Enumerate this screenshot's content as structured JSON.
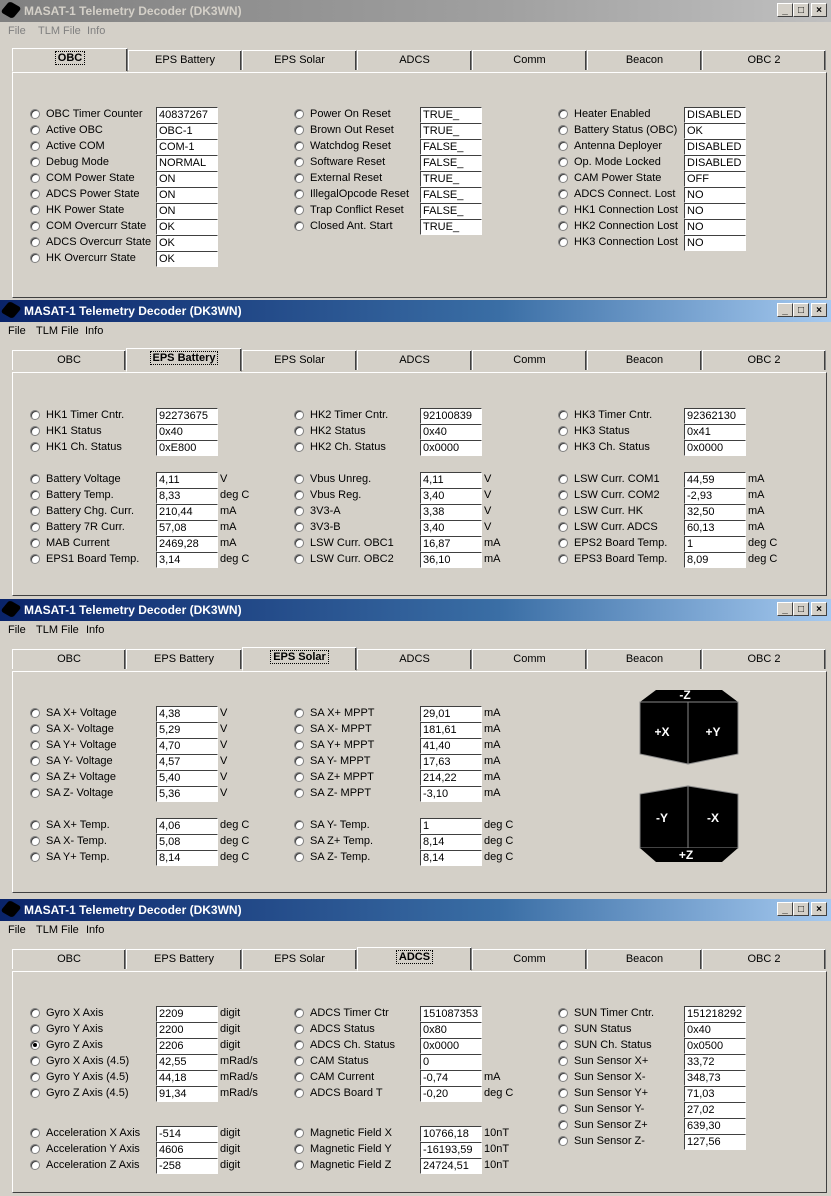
{
  "app": {
    "title": "MASAT-1 Telemetry Decoder (DK3WN)",
    "menu": [
      "File",
      "TLM File",
      "Info"
    ],
    "tabs": [
      "OBC",
      "EPS Battery",
      "EPS  Solar",
      "ADCS",
      "Comm",
      "Beacon",
      "OBC 2"
    ],
    "window_buttons": [
      "_",
      "□",
      "×"
    ]
  },
  "obc": {
    "col1": [
      {
        "label": "OBC Timer Counter",
        "value": "40837267"
      },
      {
        "label": "Active OBC",
        "value": "OBC-1"
      },
      {
        "label": "Active COM",
        "value": "COM-1"
      },
      {
        "label": "Debug Mode",
        "value": "NORMAL"
      },
      {
        "label": "COM Power State",
        "value": "ON"
      },
      {
        "label": "ADCS Power State",
        "value": "ON"
      },
      {
        "label": "HK Power State",
        "value": "ON"
      },
      {
        "label": "COM Overcurr State",
        "value": "OK"
      },
      {
        "label": "ADCS Overcurr State",
        "value": "OK"
      },
      {
        "label": "HK Overcurr State",
        "value": "OK"
      }
    ],
    "col2": [
      {
        "label": "Power On Reset",
        "value": "TRUE_"
      },
      {
        "label": "Brown Out Reset",
        "value": "TRUE_"
      },
      {
        "label": "Watchdog  Reset",
        "value": "FALSE_"
      },
      {
        "label": "Software Reset",
        "value": "FALSE_"
      },
      {
        "label": "External Reset",
        "value": "TRUE_"
      },
      {
        "label": "IllegalOpcode Reset",
        "value": "FALSE_"
      },
      {
        "label": "Trap Conflict Reset",
        "value": "FALSE_"
      },
      {
        "label": "Closed Ant. Start",
        "value": "TRUE_"
      }
    ],
    "col3": [
      {
        "label": "Heater Enabled",
        "value": "DISABLED"
      },
      {
        "label": "Battery Status (OBC)",
        "value": "OK"
      },
      {
        "label": "Antenna Deployer",
        "value": "DISABLED"
      },
      {
        "label": "Op. Mode Locked",
        "value": "DISABLED"
      },
      {
        "label": "CAM Power State",
        "value": "OFF"
      },
      {
        "label": "ADCS Connect. Lost",
        "value": "NO"
      },
      {
        "label": "HK1 Connection Lost",
        "value": "NO"
      },
      {
        "label": "HK2 Connection Lost",
        "value": "NO"
      },
      {
        "label": "HK3 Connection Lost",
        "value": "NO"
      }
    ]
  },
  "eps_battery": {
    "col1a": [
      {
        "label": "HK1 Timer Cntr.",
        "value": "92273675",
        "unit": ""
      },
      {
        "label": "HK1 Status",
        "value": "0x40",
        "unit": ""
      },
      {
        "label": "HK1 Ch. Status",
        "value": "0xE800",
        "unit": ""
      }
    ],
    "col2a": [
      {
        "label": "HK2 Timer Cntr.",
        "value": "92100839",
        "unit": ""
      },
      {
        "label": "HK2 Status",
        "value": "0x40",
        "unit": ""
      },
      {
        "label": "HK2 Ch. Status",
        "value": "0x0000",
        "unit": ""
      }
    ],
    "col3a": [
      {
        "label": "HK3 Timer Cntr.",
        "value": "92362130",
        "unit": ""
      },
      {
        "label": "HK3 Status",
        "value": "0x41",
        "unit": ""
      },
      {
        "label": "HK3 Ch. Status",
        "value": "0x0000",
        "unit": ""
      }
    ],
    "col1b": [
      {
        "label": "Battery Voltage",
        "value": "4,11",
        "unit": "V"
      },
      {
        "label": "Battery Temp.",
        "value": "8,33",
        "unit": "deg C"
      },
      {
        "label": "Battery Chg. Curr.",
        "value": "210,44",
        "unit": "mA"
      },
      {
        "label": "Battery 7R Curr.",
        "value": "57,08",
        "unit": "mA"
      },
      {
        "label": "MAB Current",
        "value": "2469,28",
        "unit": "mA"
      },
      {
        "label": "EPS1 Board Temp.",
        "value": "3,14",
        "unit": "deg C"
      }
    ],
    "col2b": [
      {
        "label": "Vbus Unreg.",
        "value": "4,11",
        "unit": "V"
      },
      {
        "label": "Vbus Reg.",
        "value": "3,40",
        "unit": "V"
      },
      {
        "label": "3V3-A",
        "value": "3,38",
        "unit": "V"
      },
      {
        "label": "3V3-B",
        "value": "3,40",
        "unit": "V"
      },
      {
        "label": "LSW Curr. OBC1",
        "value": "16,87",
        "unit": "mA"
      },
      {
        "label": "LSW Curr. OBC2",
        "value": "36,10",
        "unit": "mA"
      }
    ],
    "col3b": [
      {
        "label": "LSW Curr. COM1",
        "value": "44,59",
        "unit": "mA"
      },
      {
        "label": "LSW Curr. COM2",
        "value": "-2,93",
        "unit": "mA"
      },
      {
        "label": "LSW Curr. HK",
        "value": "32,50",
        "unit": "mA"
      },
      {
        "label": "LSW Curr. ADCS",
        "value": "60,13",
        "unit": "mA"
      },
      {
        "label": "EPS2 Board Temp.",
        "value": "1",
        "unit": "deg C"
      },
      {
        "label": "EPS3 Board Temp.",
        "value": "8,09",
        "unit": "deg C"
      }
    ]
  },
  "eps_solar": {
    "col1a": [
      {
        "label": "SA X+ Voltage",
        "value": "4,38",
        "unit": "V"
      },
      {
        "label": "SA X- Voltage",
        "value": "5,29",
        "unit": "V"
      },
      {
        "label": "SA Y+ Voltage",
        "value": "4,70",
        "unit": "V"
      },
      {
        "label": "SA Y- Voltage",
        "value": "4,57",
        "unit": "V"
      },
      {
        "label": "SA Z+ Voltage",
        "value": "5,40",
        "unit": "V"
      },
      {
        "label": "SA Z- Voltage",
        "value": "5,36",
        "unit": "V"
      }
    ],
    "col2a": [
      {
        "label": "SA X+ MPPT",
        "value": "29,01",
        "unit": "mA"
      },
      {
        "label": "SA X- MPPT",
        "value": "181,61",
        "unit": "mA"
      },
      {
        "label": "SA Y+ MPPT",
        "value": "41,40",
        "unit": "mA"
      },
      {
        "label": "SA Y- MPPT",
        "value": "17,63",
        "unit": "mA"
      },
      {
        "label": "SA Z+ MPPT",
        "value": "214,22",
        "unit": "mA"
      },
      {
        "label": "SA Z- MPPT",
        "value": "-3,10",
        "unit": "mA"
      }
    ],
    "col1b": [
      {
        "label": "SA X+ Temp.",
        "value": "4,06",
        "unit": "deg C"
      },
      {
        "label": "SA X- Temp.",
        "value": "5,08",
        "unit": "deg C"
      },
      {
        "label": "SA Y+ Temp.",
        "value": "8,14",
        "unit": "deg C"
      }
    ],
    "col2b": [
      {
        "label": "SA Y- Temp.",
        "value": "1",
        "unit": "deg C"
      },
      {
        "label": "SA Z+ Temp.",
        "value": "8,14",
        "unit": "deg C"
      },
      {
        "label": "SA Z- Temp.",
        "value": "8,14",
        "unit": "deg C"
      }
    ],
    "cube1": {
      "top": "-Z",
      "left": "+X",
      "right": "+Y"
    },
    "cube2": {
      "left": "-Y",
      "right": "-X",
      "bottom": "+Z"
    }
  },
  "adcs": {
    "col1a": [
      {
        "label": "Gyro X Axis",
        "value": "2209",
        "unit": "digit",
        "checked": false
      },
      {
        "label": "Gyro Y Axis",
        "value": "2200",
        "unit": "digit",
        "checked": false
      },
      {
        "label": "Gyro Z Axis",
        "value": "2206",
        "unit": "digit",
        "checked": true
      },
      {
        "label": "Gyro X Axis (4.5)",
        "value": "42,55",
        "unit": "mRad/s",
        "checked": false
      },
      {
        "label": "Gyro Y Axis (4.5)",
        "value": "44,18",
        "unit": "mRad/s",
        "checked": false
      },
      {
        "label": "Gyro Z Axis (4.5)",
        "value": "91,34",
        "unit": "mRad/s",
        "checked": false
      }
    ],
    "col2a": [
      {
        "label": "ADCS Timer Ctr",
        "value": "151087353",
        "unit": ""
      },
      {
        "label": "ADCS Status",
        "value": "0x80",
        "unit": ""
      },
      {
        "label": "ADCS Ch. Status",
        "value": "0x0000",
        "unit": ""
      },
      {
        "label": "CAM Status",
        "value": "0",
        "unit": ""
      },
      {
        "label": "CAM Current",
        "value": "-0,74",
        "unit": "mA"
      },
      {
        "label": "ADCS Board T",
        "value": "-0,20",
        "unit": "deg C"
      }
    ],
    "col3": [
      {
        "label": "SUN Timer Cntr.",
        "value": "151218292"
      },
      {
        "label": "SUN Status",
        "value": "0x40"
      },
      {
        "label": "SUN Ch. Status",
        "value": "0x0500"
      },
      {
        "label": "Sun Sensor X+",
        "value": "33,72"
      },
      {
        "label": "Sun Sensor X-",
        "value": "348,73"
      },
      {
        "label": "Sun Sensor Y+",
        "value": "71,03"
      },
      {
        "label": "Sun Sensor Y-",
        "value": "27,02"
      },
      {
        "label": "Sun Sensor Z+",
        "value": "639,30"
      },
      {
        "label": "Sun Sensor Z-",
        "value": "127,56"
      }
    ],
    "col1b": [
      {
        "label": "Acceleration X Axis",
        "value": "-514",
        "unit": "digit"
      },
      {
        "label": "Acceleration Y Axis",
        "value": "4606",
        "unit": "digit"
      },
      {
        "label": "Acceleration Z Axis",
        "value": "-258",
        "unit": "digit"
      }
    ],
    "col2b": [
      {
        "label": "Magnetic Field X",
        "value": "10766,18",
        "unit": "10nT"
      },
      {
        "label": "Magnetic Field Y",
        "value": "-16193,59",
        "unit": "10nT"
      },
      {
        "label": "Magnetic Field Z",
        "value": "24724,51",
        "unit": "10nT"
      }
    ]
  }
}
